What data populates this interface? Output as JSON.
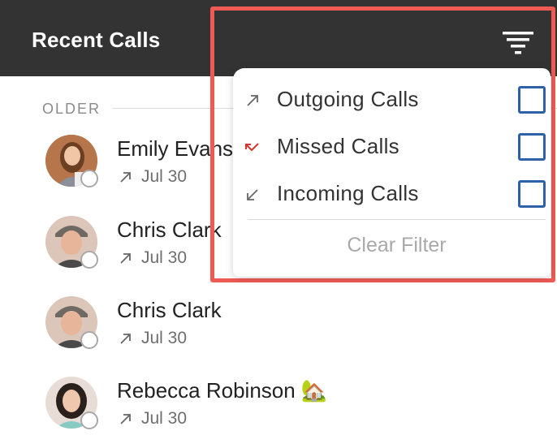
{
  "header": {
    "title": "Recent Calls"
  },
  "section": {
    "label": "OLDER"
  },
  "calls": [
    {
      "name": "Emily Evans",
      "date": "Jul 30",
      "direction": "outgoing"
    },
    {
      "name": "Chris Clark",
      "date": "Jul 30",
      "direction": "outgoing"
    },
    {
      "name": "Chris Clark",
      "date": "Jul 30",
      "direction": "outgoing"
    },
    {
      "name": "Rebecca Robinson 🏡",
      "date": "Jul 30",
      "direction": "outgoing"
    }
  ],
  "filter_menu": {
    "options": [
      {
        "label": "Outgoing Calls",
        "icon": "arrow-up-right-icon",
        "checked": false
      },
      {
        "label": "Missed Calls",
        "icon": "missed-call-icon",
        "checked": false
      },
      {
        "label": "Incoming Calls",
        "icon": "arrow-down-left-icon",
        "checked": false
      }
    ],
    "clear_label": "Clear Filter"
  },
  "colors": {
    "header_bg": "#333333",
    "highlight_frame": "#f05a55",
    "checkbox_border": "#2e62a8",
    "missed_red": "#d9342b"
  }
}
